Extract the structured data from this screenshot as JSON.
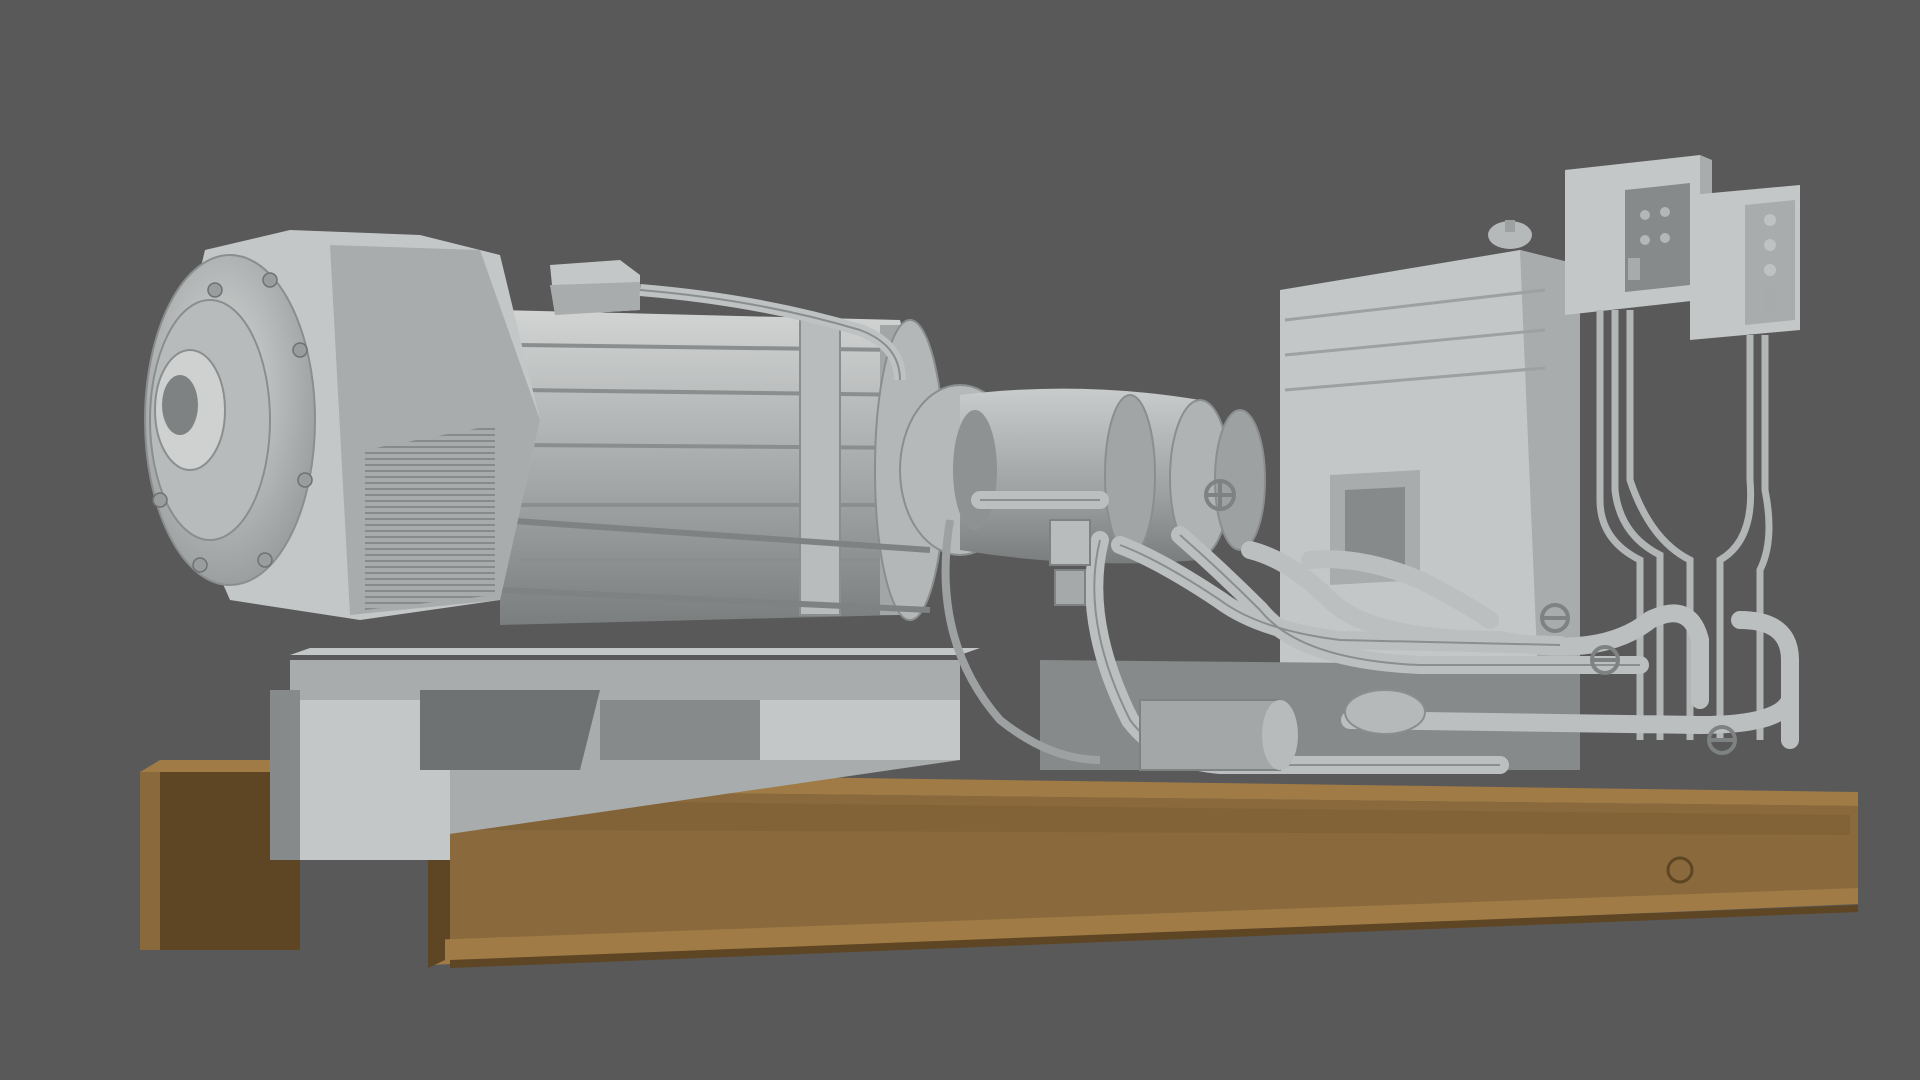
{
  "scene": {
    "subject": "generator-set-render",
    "colors": {
      "background": "#595959",
      "model_light": "#c4c7c7",
      "model_mid": "#a9acac",
      "model_dark": "#878a8a",
      "model_shadow": "#6f7272",
      "beam": "#8a6a3c",
      "beam_light": "#a07b45",
      "beam_dark": "#5e4524"
    },
    "icons": [
      "motor",
      "turbine",
      "piping",
      "valve",
      "control-panel",
      "steel-beam"
    ]
  }
}
